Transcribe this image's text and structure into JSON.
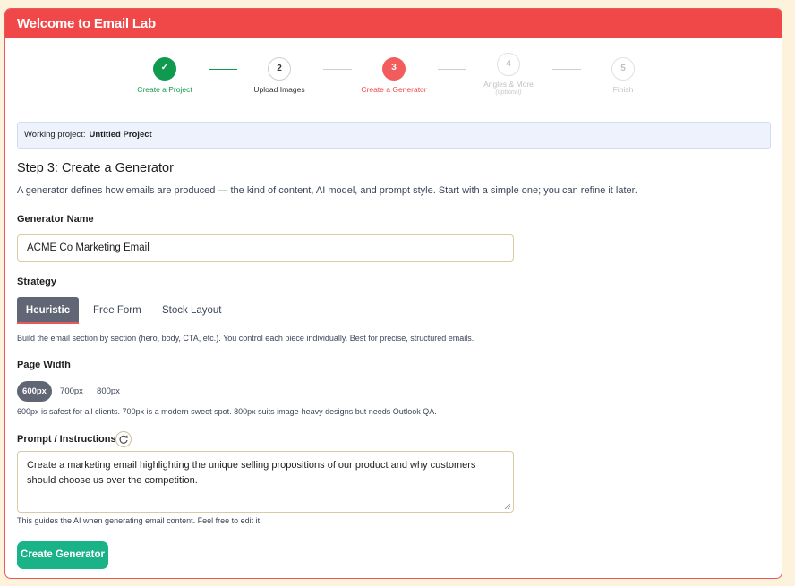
{
  "header": {
    "title": "Welcome to Email Lab"
  },
  "stepper": [
    {
      "number": "✓",
      "label": "Create a Project",
      "sub": "",
      "state": "done"
    },
    {
      "number": "2",
      "label": "Upload Images",
      "sub": "",
      "state": "visited"
    },
    {
      "number": "3",
      "label": "Create a Generator",
      "sub": "",
      "state": "active"
    },
    {
      "number": "4",
      "label": "Angles & More",
      "sub": "(optional)",
      "state": "pending"
    },
    {
      "number": "5",
      "label": "Finish",
      "sub": "",
      "state": "pending"
    }
  ],
  "working_project": {
    "label": "Working project:",
    "name": "Untitled Project"
  },
  "step_title": "Step 3: Create a Generator",
  "step_description": "A generator defines how emails are produced — the kind of content, AI model, and prompt style. Start with a simple one; you can refine it later.",
  "generator_name": {
    "label": "Generator Name",
    "value": "ACME Co Marketing Email"
  },
  "strategy": {
    "label": "Strategy",
    "options": [
      "Heuristic",
      "Free Form",
      "Stock Layout"
    ],
    "selected": "Heuristic",
    "help": "Build the email section by section (hero, body, CTA, etc.). You control each piece individually. Best for precise, structured emails."
  },
  "page_width": {
    "label": "Page Width",
    "options": [
      "600px",
      "700px",
      "800px"
    ],
    "selected": "600px",
    "help": "600px is safest for all clients. 700px is a modern sweet spot. 800px suits image-heavy designs but needs Outlook QA."
  },
  "prompt": {
    "label": "Prompt / Instructions",
    "icon": "refresh-icon",
    "value": "Create a marketing email highlighting the unique selling propositions of our product and why customers should choose us over the competition.",
    "help": "This guides the AI when generating email content. Feel free to edit it."
  },
  "submit": {
    "label": "Create Generator"
  },
  "colors": {
    "header": "#f04848",
    "done": "#0f9a4f",
    "active": "#f25c5c",
    "primary_button": "#1ab387",
    "selected_segment": "#606673"
  }
}
